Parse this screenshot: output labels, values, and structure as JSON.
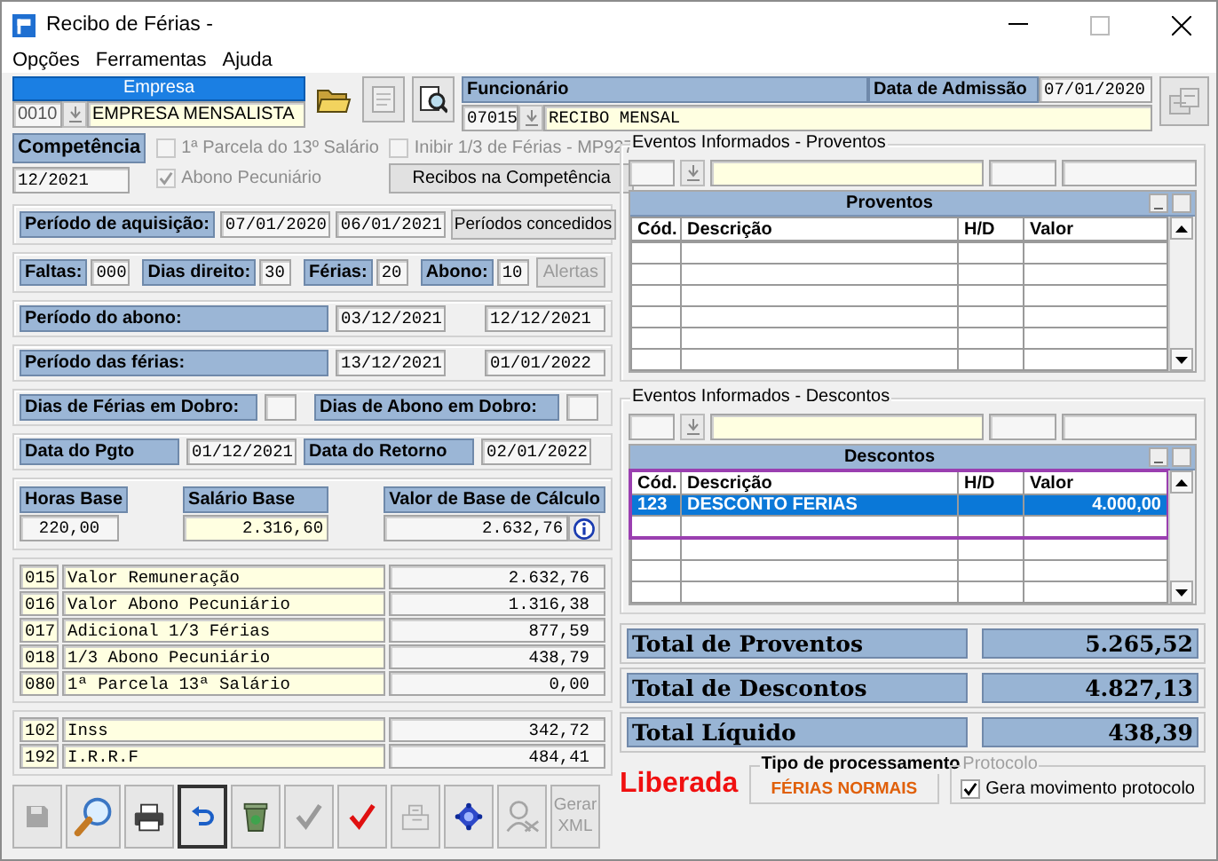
{
  "window": {
    "title": "Recibo de Férias -"
  },
  "menu": [
    "Opções",
    "Ferramentas",
    "Ajuda"
  ],
  "empresa": {
    "header": "Empresa",
    "code": "0010",
    "name": "EMPRESA MENSALISTA"
  },
  "funcionario": {
    "header": "Funcionário",
    "code": "07015",
    "name": "RECIBO MENSAL",
    "admission_label": "Data de Admissão",
    "admission_date": "07/01/2020"
  },
  "competencia": {
    "label": "Competência",
    "value": "12/2021"
  },
  "options": [
    {
      "label": "1ª Parcela do 13º Salário",
      "checked": false,
      "disabled": true
    },
    {
      "label": "Abono Pecuniário",
      "checked": true,
      "disabled": true
    },
    {
      "label": "Inibir 1/3 de Férias - MP927",
      "checked": false,
      "disabled": true
    }
  ],
  "recibos_button": "Recibos na Competência",
  "aquisicao": {
    "label": "Período de aquisição:",
    "start": "07/01/2020",
    "end": "06/01/2021",
    "button": "Períodos concedidos"
  },
  "days": [
    {
      "label": "Faltas:",
      "value": "000"
    },
    {
      "label": "Dias direito:",
      "value": "30"
    },
    {
      "label": "Férias:",
      "value": "20"
    },
    {
      "label": "Abono:",
      "value": "10"
    }
  ],
  "alertas_button": {
    "label": "Alertas",
    "disabled": true
  },
  "periods": [
    {
      "label": "Período do abono:",
      "start": "03/12/2021",
      "end": "12/12/2021"
    },
    {
      "label": "Período das férias:",
      "start": "13/12/2021",
      "end": "01/01/2022"
    }
  ],
  "dobro": [
    {
      "label": "Dias de Férias em Dobro:"
    },
    {
      "label": "Dias de Abono em Dobro:"
    }
  ],
  "dates": [
    {
      "label": "Data do Pgto",
      "value": "01/12/2021"
    },
    {
      "label": "Data do Retorno",
      "value": "02/01/2022"
    }
  ],
  "base": [
    {
      "label": "Horas Base",
      "value": "220,00"
    },
    {
      "label": "Salário Base",
      "value": "2.316,60"
    },
    {
      "label": "Valor de Base de Cálculo",
      "value": "2.632,76"
    }
  ],
  "earnings": [
    {
      "code": "015",
      "description": "Valor Remuneração",
      "value": "2.632,76"
    },
    {
      "code": "016",
      "description": "Valor Abono Pecuniário",
      "value": "1.316,38"
    },
    {
      "code": "017",
      "description": "Adicional 1/3 Férias",
      "value": "877,59"
    },
    {
      "code": "018",
      "description": "1/3 Abono Pecuniário",
      "value": "438,79"
    },
    {
      "code": "080",
      "description": "1ª Parcela 13ª Salário",
      "value": "0,00"
    }
  ],
  "deductions": [
    {
      "code": "102",
      "description": "Inss",
      "value": "342,72"
    },
    {
      "code": "192",
      "description": "I.R.R.F",
      "value": "484,41"
    }
  ],
  "toolbar": [
    {
      "kind": "save",
      "disabled": true,
      "selected": false
    },
    {
      "kind": "search",
      "disabled": false,
      "selected": false
    },
    {
      "kind": "print",
      "disabled": false,
      "selected": false
    },
    {
      "kind": "undo",
      "disabled": false,
      "selected": true
    },
    {
      "kind": "recycle",
      "disabled": false,
      "selected": false
    },
    {
      "kind": "check",
      "disabled": true,
      "selected": false
    },
    {
      "kind": "check",
      "disabled": false,
      "selected": false
    },
    {
      "kind": "transfer",
      "disabled": true,
      "selected": false
    },
    {
      "kind": "network",
      "disabled": false,
      "selected": false
    },
    {
      "kind": "person",
      "disabled": true,
      "selected": false
    },
    {
      "kind": "text",
      "label": "Gerar XML",
      "disabled": true,
      "selected": false
    }
  ],
  "proventos": {
    "group_title": "Eventos Informados - Proventos",
    "grid_title": "Proventos",
    "columns": [
      "Cód.",
      "Descrição",
      "H/D",
      "Valor"
    ]
  },
  "descontos": {
    "group_title": "Eventos Informados - Descontos",
    "grid_title": "Descontos",
    "columns": [
      "Cód.",
      "Descrição",
      "H/D",
      "Valor"
    ],
    "rows": [
      {
        "code": "123",
        "description": "DESCONTO FERIAS",
        "value": "4.000,00",
        "selected": true
      }
    ]
  },
  "totals": [
    {
      "label": "Total de Proventos",
      "value": "5.265,52"
    },
    {
      "label": "Total de Descontos",
      "value": "4.827,13"
    },
    {
      "label": "Total Líquido",
      "value": "438,39"
    }
  ],
  "status": "Liberada",
  "processing": {
    "title": "Tipo de processamento",
    "value": "FÉRIAS NORMAIS"
  },
  "protocolo": {
    "title": "Protocolo",
    "label": "Gera movimento protocolo",
    "checked": true
  }
}
